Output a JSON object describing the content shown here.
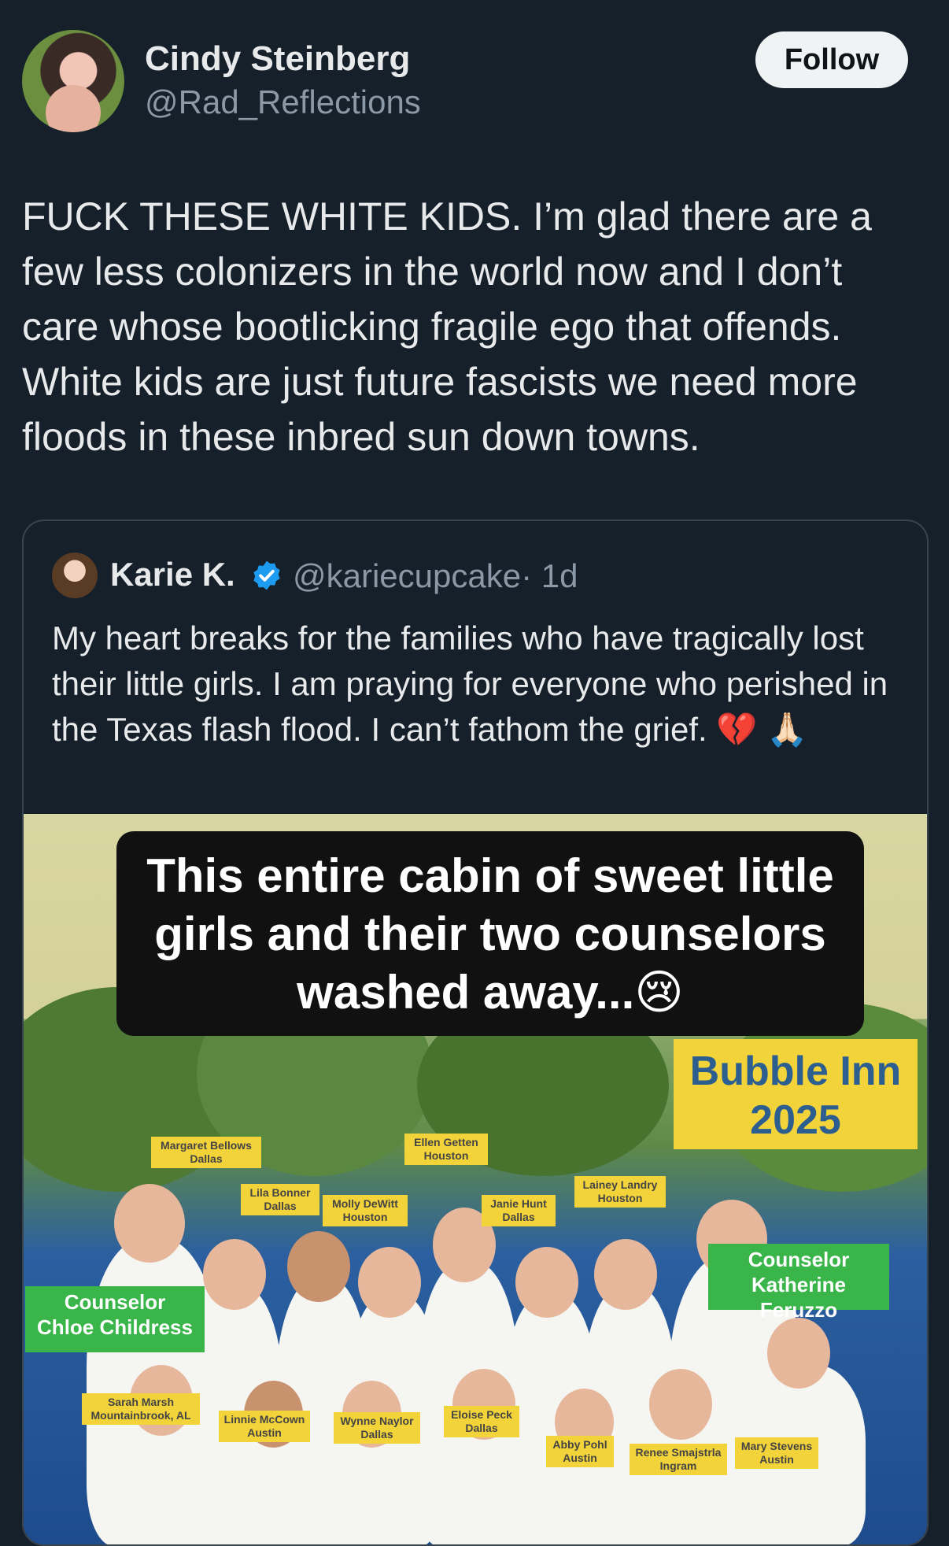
{
  "post": {
    "author": {
      "display_name": "Cindy Steinberg",
      "handle": "@Rad_Reflections"
    },
    "follow_label": "Follow",
    "text": "FUCK THESE WHITE KIDS. I’m glad there are a few less colonizers in the world now and I don’t care whose bootlicking fragile ego that offends. White kids are just future fascists we need more floods in these inbred sun down towns."
  },
  "quoted_post": {
    "author": {
      "display_name": "Karie K.",
      "handle": "@kariecupcake",
      "time": "· 1d"
    },
    "text": "My heart breaks for the families who have tragically lost their little girls.  I am praying for everyone who perished in the Texas flash flood.  I can’t fathom the grief. 💔 🙏🏻",
    "media": {
      "caption": "This entire cabin of sweet little girls and their two counselors washed away...😢",
      "label_line1": "Bubble Inn",
      "label_line2": "2025",
      "counselors": [
        {
          "line1": "Counselor",
          "line2": "Chloe Childress"
        },
        {
          "line1": "Counselor",
          "line2": "Katherine Feruzzo"
        }
      ],
      "name_tags": [
        {
          "name": "Margaret Bellows",
          "city": "Dallas"
        },
        {
          "name": "Ellen Getten",
          "city": "Houston"
        },
        {
          "name": "Lila Bonner",
          "city": "Dallas"
        },
        {
          "name": "Molly DeWitt",
          "city": "Houston"
        },
        {
          "name": "Janie Hunt",
          "city": "Dallas"
        },
        {
          "name": "Lainey Landry",
          "city": "Houston"
        },
        {
          "name": "Sarah Marsh",
          "city": "Mountainbrook, AL"
        },
        {
          "name": "Linnie McCown",
          "city": "Austin"
        },
        {
          "name": "Wynne Naylor",
          "city": "Dallas"
        },
        {
          "name": "Eloise Peck",
          "city": "Dallas"
        },
        {
          "name": "Abby Pohl",
          "city": "Austin"
        },
        {
          "name": "Renee Smajstrla",
          "city": "Ingram"
        },
        {
          "name": "Mary Stevens",
          "city": "Austin"
        }
      ]
    }
  },
  "colors": {
    "background": "#15202b",
    "text_primary": "#e7e9ea",
    "text_secondary": "#8b98a5",
    "verified": "#1d9bf0",
    "tag_yellow": "#f3d33a",
    "counselor_green": "#3ab54a"
  }
}
